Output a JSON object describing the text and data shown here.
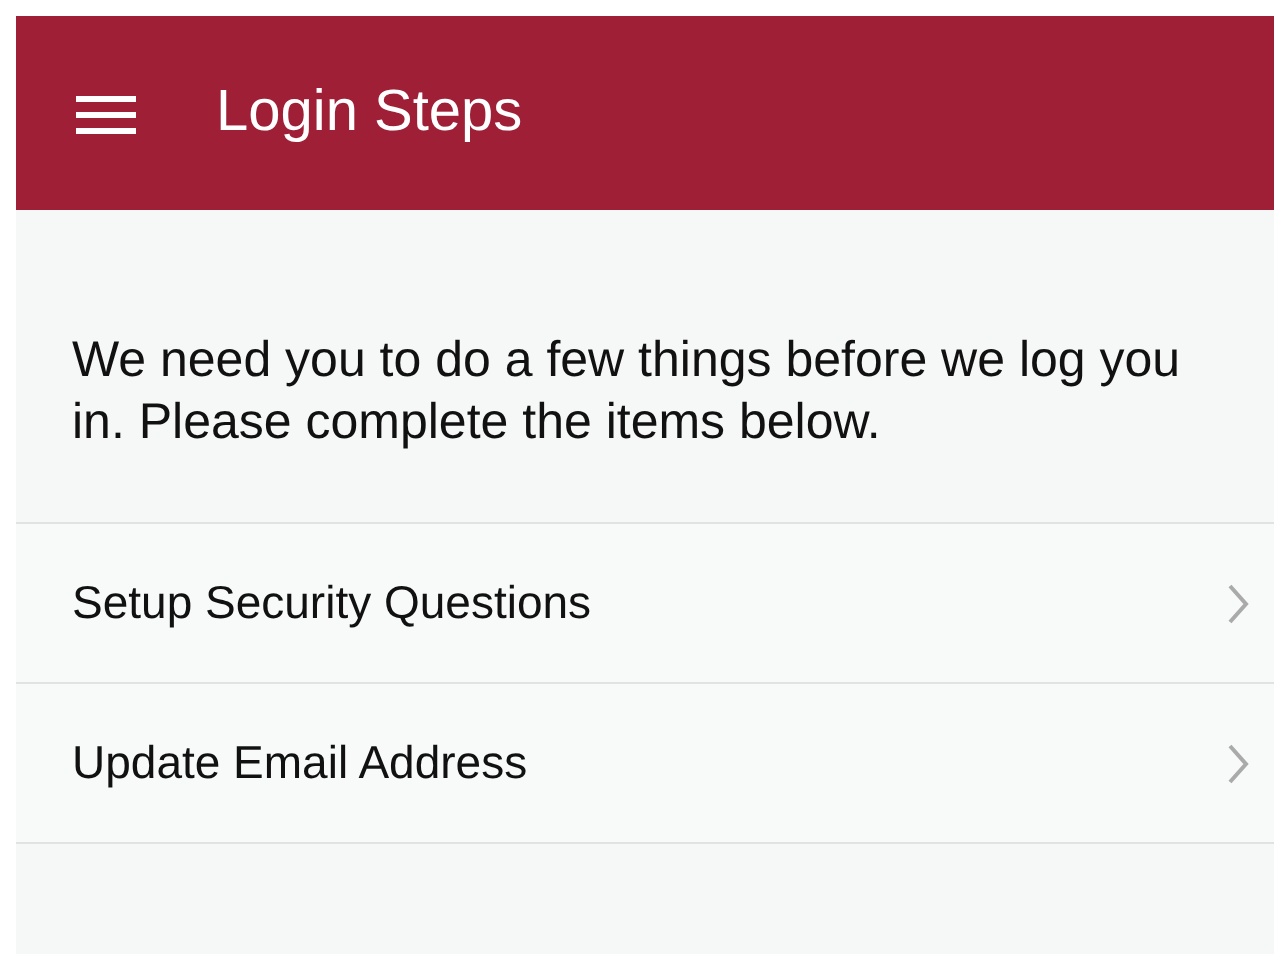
{
  "app_bar": {
    "title": "Login Steps"
  },
  "message": "We need you to do a few things before we log you in. Please complete the items below.",
  "steps": [
    {
      "label": "Setup Security Questions"
    },
    {
      "label": "Update Email Address"
    }
  ]
}
